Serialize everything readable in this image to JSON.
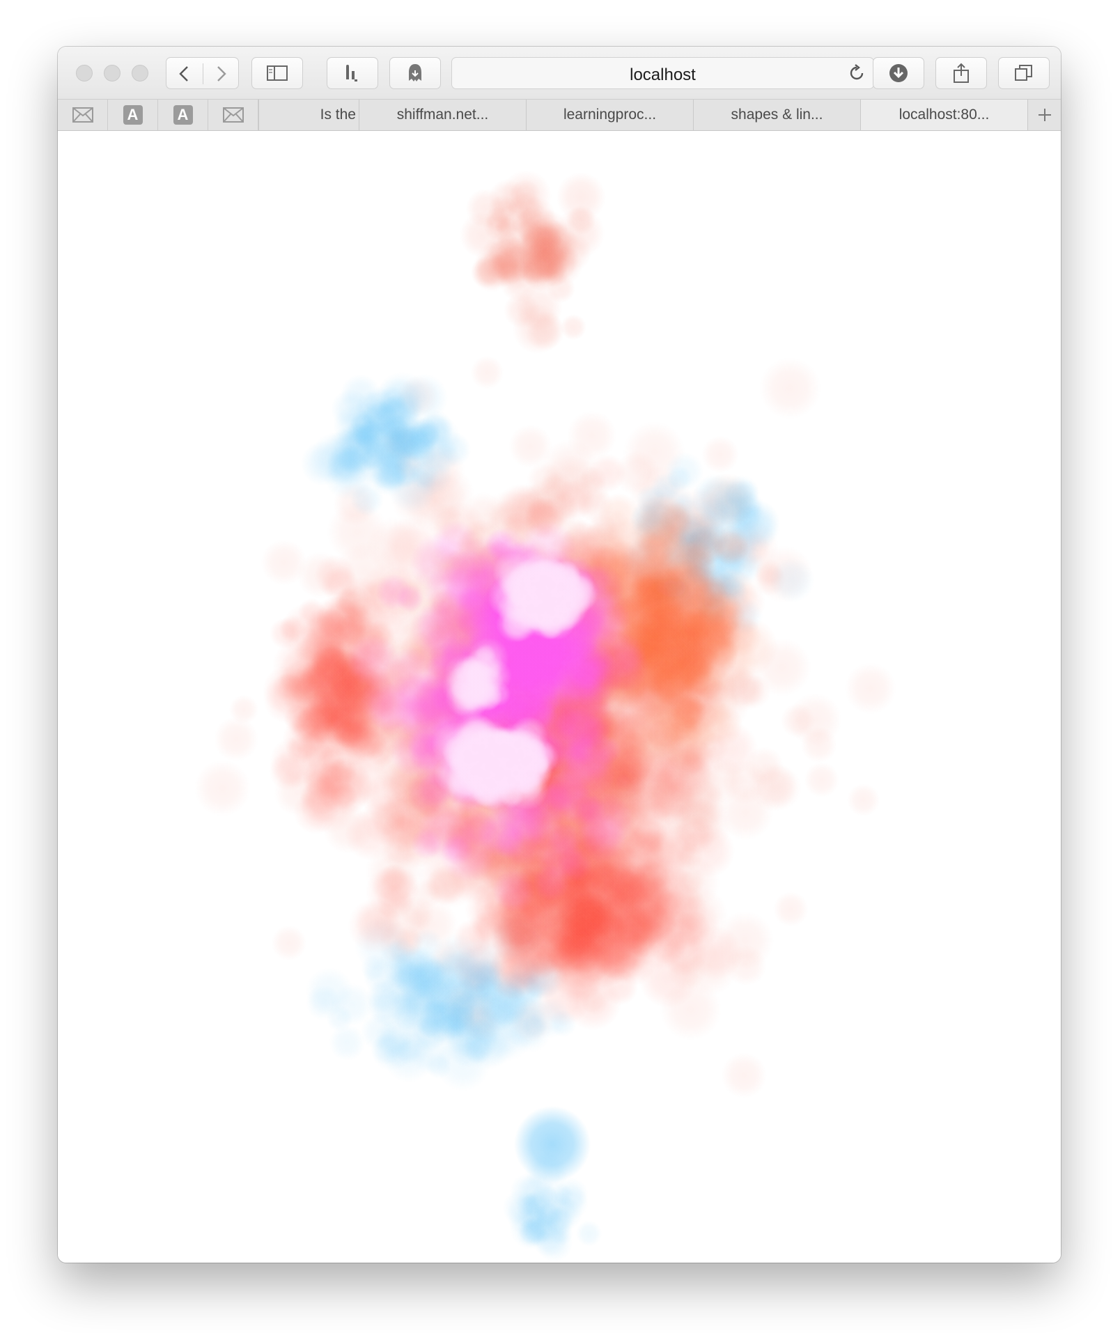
{
  "browser": {
    "address": "localhost",
    "tabs": [
      {
        "label": "Is the"
      },
      {
        "label": "shiffman.net..."
      },
      {
        "label": "learningproc..."
      },
      {
        "label": "shapes & lin..."
      },
      {
        "label": "localhost:80..."
      }
    ],
    "favorites": [
      {
        "icon": "mail-icon"
      },
      {
        "icon": "a-icon",
        "letter": "A"
      },
      {
        "icon": "a-icon",
        "letter": "A"
      },
      {
        "icon": "mail-icon"
      }
    ]
  },
  "canvas": {
    "colors": {
      "blue": "#5bc0f8",
      "red": "#ff4b3c",
      "orange": "#ff6a3a",
      "coral": "#f5806e",
      "magenta": "#ff5cf0",
      "pale_pink": "#ffe2fc",
      "background": "#ffffff"
    }
  }
}
